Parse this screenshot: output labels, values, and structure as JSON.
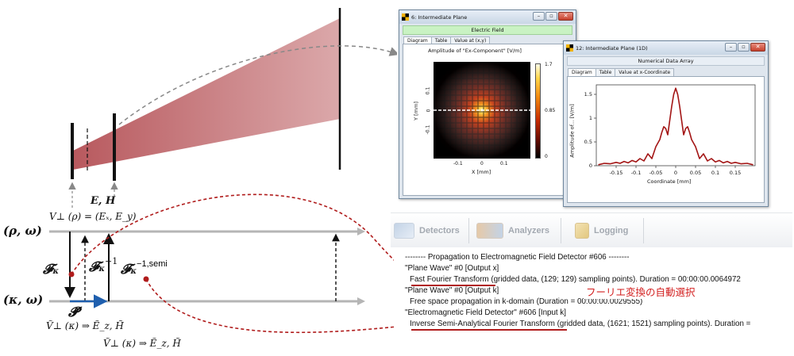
{
  "diagram": {
    "field_label": "E, H",
    "v_perp_rho": "V⊥ (ρ) = (Eₓ, E_y)",
    "rho_omega": "(ρ, ω)",
    "kappa_omega": "(κ, ω)",
    "f_kappa": "𝓕",
    "f_kappa_sub": "κ",
    "f_inv": "𝓕",
    "f_inv_sub": "κ",
    "f_inv_sup": "−1",
    "f_semi": "𝓕",
    "f_semi_sub": "κ",
    "f_semi_sup": "−1,semi",
    "p_tilde": "𝓟̃",
    "v_kappa_1": "Ṽ⊥ (κ) ⇒ Ẽ_z, H̃",
    "v_kappa_2": "Ṽ⊥ (κ) ⇒ Ẽ_z, H̃"
  },
  "window_2d": {
    "title": "6: Intermediate Plane",
    "banner": "Electric Field",
    "tabs": [
      "Diagram",
      "Table",
      "Value at (x,y)"
    ],
    "plot_title": "Amplitude of \"Ex-Component\"  [V/m]",
    "colorbar_ticks": [
      "1.7",
      "0.85",
      "0"
    ],
    "y_ticks": [
      "0.1",
      "0",
      "-0.1"
    ],
    "x_ticks": [
      "-0.1",
      "0",
      "0.1"
    ],
    "x_label": "X [mm]",
    "y_label": "Y [mm]"
  },
  "window_1d": {
    "title": "12: Intermediate Plane (1D)",
    "banner": "Numerical Data Array",
    "tabs": [
      "Diagram",
      "Table",
      "Value at x-Coordinate"
    ],
    "x_label": "Coordinate [mm]",
    "y_label": "Amplitude of... [V/m]"
  },
  "chart_data": {
    "type": "line",
    "xlabel": "Coordinate [mm]",
    "ylabel": "Amplitude of... [V/m]",
    "xlim": [
      -0.2,
      0.2
    ],
    "ylim": [
      0,
      1.7
    ],
    "x_ticks": [
      "-0.15",
      "-0.1",
      "-0.05",
      "0",
      "0.05",
      "0.1",
      "0.15"
    ],
    "y_ticks": [
      "0",
      "0.5",
      "1",
      "1.5"
    ],
    "series": [
      {
        "color": "#a31515",
        "x": [
          -0.195,
          -0.18,
          -0.165,
          -0.15,
          -0.14,
          -0.13,
          -0.12,
          -0.11,
          -0.1,
          -0.09,
          -0.08,
          -0.07,
          -0.06,
          -0.05,
          -0.04,
          -0.035,
          -0.03,
          -0.025,
          -0.02,
          -0.015,
          -0.01,
          -0.005,
          0,
          0.005,
          0.01,
          0.015,
          0.02,
          0.025,
          0.03,
          0.035,
          0.04,
          0.05,
          0.06,
          0.07,
          0.08,
          0.09,
          0.1,
          0.11,
          0.12,
          0.13,
          0.14,
          0.15,
          0.165,
          0.18,
          0.195
        ],
        "y": [
          0.02,
          0.05,
          0.04,
          0.07,
          0.05,
          0.09,
          0.06,
          0.11,
          0.08,
          0.15,
          0.1,
          0.25,
          0.15,
          0.4,
          0.55,
          0.7,
          0.82,
          0.78,
          0.65,
          0.95,
          1.25,
          1.5,
          1.63,
          1.5,
          1.25,
          0.95,
          0.65,
          0.78,
          0.82,
          0.7,
          0.55,
          0.4,
          0.15,
          0.25,
          0.1,
          0.15,
          0.08,
          0.11,
          0.06,
          0.09,
          0.05,
          0.07,
          0.04,
          0.05,
          0.02
        ]
      }
    ]
  },
  "toolbar": {
    "detectors": "Detectors",
    "analyzers": "Analyzers",
    "logging": "Logging"
  },
  "log": {
    "lines": [
      "-------- Propagation to Electromagnetic Field Detector #606 --------",
      "\"Plane Wave\" #0 [Output x]",
      "Fast Fourier Transform (gridded data, (129; 129) sampling points). Duration = 00:00:00.0064972",
      "\"Plane Wave\" #0 [Output k]",
      "  Free space propagation in k-domain (Duration = 00:00:00.0029555)",
      "\"Electromagnetic Field Detector\" #606 [Input k]",
      "Inverse Semi-Analytical Fourier Transform (gridded data, (1621; 1521) sampling points). Duration ="
    ],
    "annotation_jp": "フーリエ変換の自動選択"
  },
  "colors": {
    "beam": "#c97a7e",
    "accent_red": "#b01c1c",
    "arrow_blue": "#1f5fae",
    "axis_gray": "#b5b5b5"
  }
}
